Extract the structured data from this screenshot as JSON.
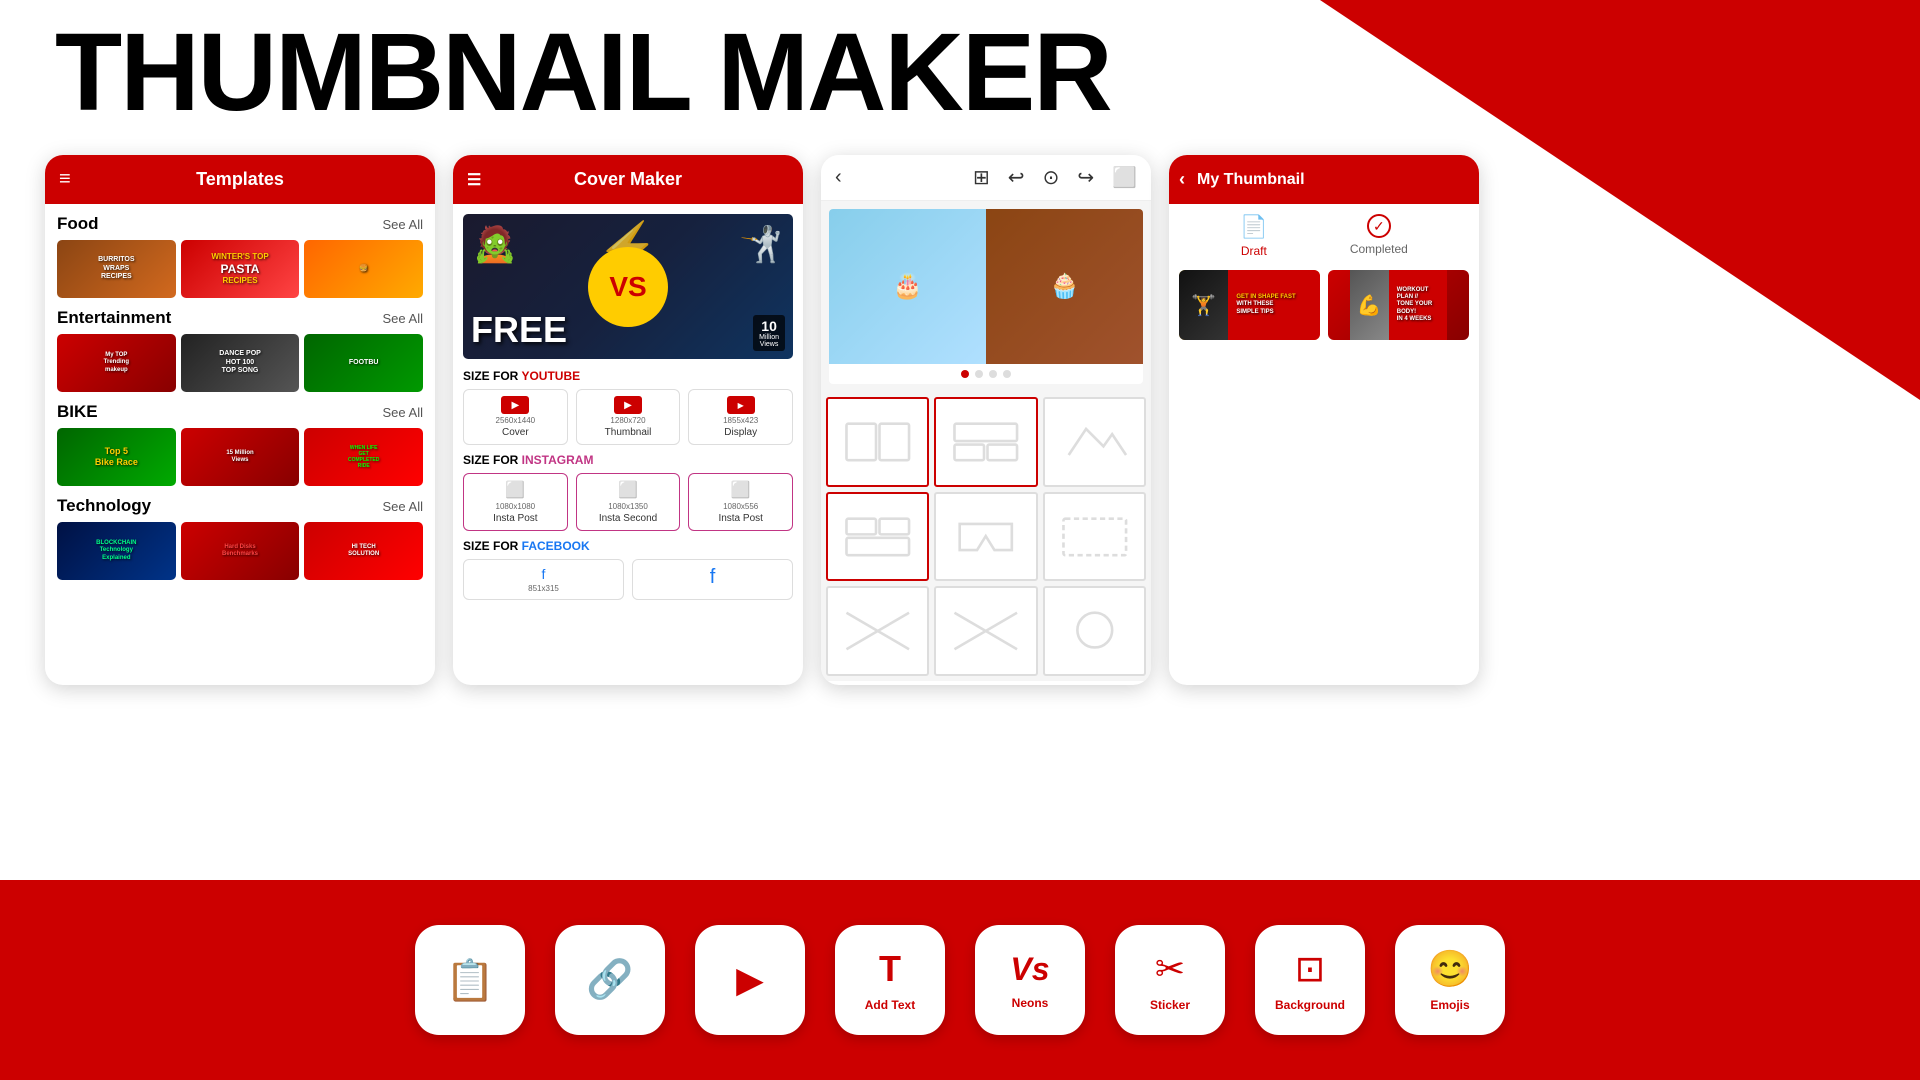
{
  "app": {
    "title": "THUMBNAIL MAKER"
  },
  "screen1": {
    "header": "Templates",
    "sections": [
      {
        "name": "Food",
        "see_all": "See All",
        "items": [
          {
            "text": "BURRITOS WRAPS RECIPES"
          },
          {
            "text": "WINTER'S TOP PASTA RECIPES"
          },
          {
            "text": ""
          }
        ]
      },
      {
        "name": "Entertainment",
        "see_all": "See All",
        "items": [
          {
            "text": "My TOP Trending makeup tutorial"
          },
          {
            "text": "DANCE POP HOT 100 TOP SONG"
          },
          {
            "text": "FOOTBU"
          }
        ]
      },
      {
        "name": "BIKE",
        "see_all": "See All",
        "items": [
          {
            "text": "Top 5 Bike Race"
          },
          {
            "text": "15 Million Views"
          },
          {
            "text": "WHEN LIFE GET COMPLETED RIDE"
          }
        ]
      },
      {
        "name": "Technology",
        "see_all": "See All",
        "items": [
          {
            "text": "BLOCKCHAIN Technology Explained"
          },
          {
            "text": "Hard Disks Benchmarks"
          },
          {
            "text": "HI TECH SOLUTION"
          }
        ]
      }
    ]
  },
  "screen2": {
    "header": "Cover Maker",
    "cover_text": "FREE",
    "views_text": "10 Million Views",
    "vs_text": "VS",
    "size_youtube": "SIZE FOR YOUTUBE",
    "youtube_label": "YOUTUBE",
    "size_options_yt": [
      {
        "dim": "2560x1440",
        "name": "Cover"
      },
      {
        "dim": "1280x720",
        "name": "Thumbnail"
      },
      {
        "dim": "1855x423",
        "name": "Display"
      }
    ],
    "size_instagram": "SIZE FOR INSTAGRAM",
    "instagram_label": "INSTAGRAM",
    "size_options_ig": [
      {
        "dim": "1080x1080",
        "name": "Insta Post"
      },
      {
        "dim": "1080x1350",
        "name": "Insta Second"
      },
      {
        "dim": "1080x556",
        "name": "Insta Post"
      }
    ],
    "size_facebook": "SIZE FOR FACEBOOK",
    "facebook_label": "FACEBOOK"
  },
  "screen3": {
    "dots": [
      true,
      false,
      false,
      false
    ]
  },
  "screen4": {
    "header": "My Thumbnail",
    "tabs": [
      {
        "name": "Draft",
        "type": "doc"
      },
      {
        "name": "Completed",
        "type": "check"
      }
    ],
    "thumbnails": [
      {
        "text": "GET IN SHAPE FAST WITH THESE SIMPLE TIPS"
      },
      {
        "text": "WORKOUT PLAN // TONE YOUR BODY! IN 4 WEEKS"
      }
    ]
  },
  "bottom_bar": {
    "left_buttons": [
      {
        "icon": "📄",
        "label": "",
        "color": "orange"
      },
      {
        "icon": "🔗",
        "label": "",
        "color": "purple"
      },
      {
        "icon": "▶",
        "label": "",
        "color": "red"
      }
    ],
    "right_buttons": [
      {
        "icon": "T",
        "label": "Add Text"
      },
      {
        "icon": "Vs",
        "label": "Neons"
      },
      {
        "icon": "✂",
        "label": "Sticker"
      },
      {
        "icon": "⊡",
        "label": "Background"
      },
      {
        "icon": "☺",
        "label": "Emojis"
      }
    ]
  }
}
